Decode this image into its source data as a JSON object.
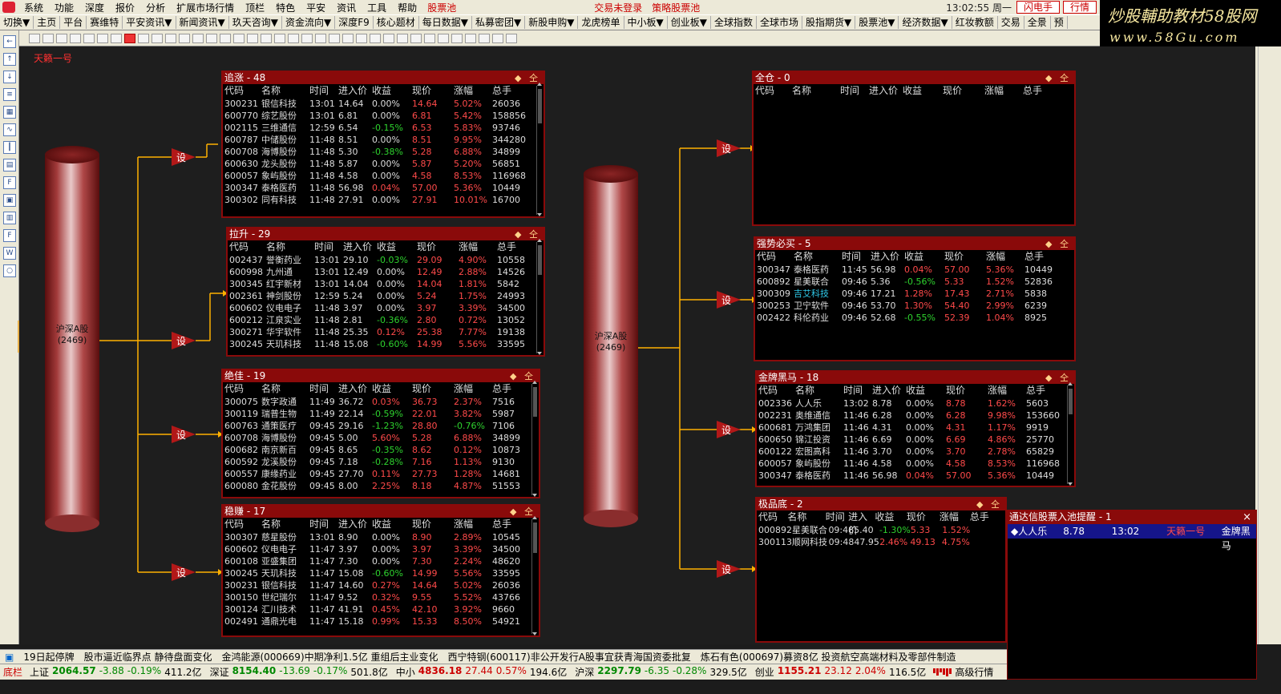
{
  "menu": {
    "items": [
      "系统",
      "功能",
      "深度",
      "报价",
      "分析",
      "扩展市场行情",
      "顶栏",
      "特色",
      "平安",
      "资讯",
      "工具",
      "帮助"
    ],
    "stock_pool": "股票池",
    "trade_status": "交易未登录",
    "strategy": "策略股票池",
    "clock": "13:02:55 周一",
    "flash_btn": "闪电手",
    "quote_btn": "行情"
  },
  "watermark": {
    "line1": "炒股輔助教材58股网",
    "line2": "www.58Gu.com"
  },
  "topbar": {
    "items": [
      "切换▼",
      "主页",
      "平台",
      "赛维特",
      "平安资讯▼",
      "新闻资讯▼",
      "玖天咨询▼",
      "资金流向▼",
      "深度F9",
      "核心题材",
      "每日数据▼",
      "私募密团▼",
      "新股申购▼",
      "龙虎榜单",
      "中小板▼",
      "创业板▼",
      "全球指数",
      "全球市场",
      "股指期货▼",
      "股票池▼",
      "经济数据▼",
      "红妆教额",
      "交易",
      "全景",
      "预"
    ]
  },
  "scheme_title": "天籁一号",
  "node_label": "设",
  "cylinders": [
    {
      "label": "沪深A股",
      "count": "(2469)"
    },
    {
      "label": "沪深A股",
      "count": "(2469)"
    }
  ],
  "columns": [
    "代码",
    "名称",
    "时间",
    "进入价",
    "收益",
    "现价",
    "涨幅",
    "总手"
  ],
  "panels": [
    {
      "title": "追涨 - 48",
      "icons": "◆ 仝",
      "rows": [
        [
          "300231",
          "银信科技",
          "13:01",
          "14.64",
          "0.00%",
          "14.64",
          "5.02%",
          "26036"
        ],
        [
          "600770",
          "综艺股份",
          "13:01",
          "6.81",
          "0.00%",
          "6.81",
          "5.42%",
          "158856"
        ],
        [
          "002115",
          "三维通信",
          "12:59",
          "6.54",
          "-0.15%",
          "6.53",
          "5.83%",
          "93746"
        ],
        [
          "600787",
          "中储股份",
          "11:48",
          "8.51",
          "0.00%",
          "8.51",
          "9.95%",
          "344280"
        ],
        [
          "600708",
          "海博股份",
          "11:48",
          "5.30",
          "-0.38%",
          "5.28",
          "6.88%",
          "34899"
        ],
        [
          "600630",
          "龙头股份",
          "11:48",
          "5.87",
          "0.00%",
          "5.87",
          "5.20%",
          "56851"
        ],
        [
          "600057",
          "象屿股份",
          "11:48",
          "4.58",
          "0.00%",
          "4.58",
          "8.53%",
          "116968"
        ],
        [
          "300347",
          "泰格医药",
          "11:48",
          "56.98",
          "0.04%",
          "57.00",
          "5.36%",
          "10449"
        ],
        [
          "300302",
          "同有科技",
          "11:48",
          "27.91",
          "0.00%",
          "27.91",
          "10.01%",
          "16700"
        ]
      ]
    },
    {
      "title": "拉升 - 29",
      "icons": "◆ 仝",
      "rows": [
        [
          "002437",
          "誉衡药业",
          "13:01",
          "29.10",
          "-0.03%",
          "29.09",
          "4.90%",
          "10558"
        ],
        [
          "600998",
          "九州通",
          "13:01",
          "12.49",
          "0.00%",
          "12.49",
          "2.88%",
          "14526"
        ],
        [
          "300345",
          "红宇新材",
          "13:01",
          "14.04",
          "0.00%",
          "14.04",
          "1.81%",
          "5842"
        ],
        [
          "002361",
          "神剑股份",
          "12:59",
          "5.24",
          "0.00%",
          "5.24",
          "1.75%",
          "24993"
        ],
        [
          "600602",
          "仪电电子",
          "11:48",
          "3.97",
          "0.00%",
          "3.97",
          "3.39%",
          "34500"
        ],
        [
          "600212",
          "江泉实业",
          "11:48",
          "2.81",
          "-0.36%",
          "2.80",
          "0.72%",
          "13052"
        ],
        [
          "300271",
          "华宇软件",
          "11:48",
          "25.35",
          "0.12%",
          "25.38",
          "7.77%",
          "19138"
        ],
        [
          "300245",
          "天玑科技",
          "11:48",
          "15.08",
          "-0.60%",
          "14.99",
          "5.56%",
          "33595"
        ]
      ]
    },
    {
      "title": "绝佳 - 19",
      "icons": "◆ 仝",
      "rows": [
        [
          "300075",
          "数字政通",
          "11:49",
          "36.72",
          "0.03%",
          "36.73",
          "2.37%",
          "7516"
        ],
        [
          "300119",
          "瑞普生物",
          "11:49",
          "22.14",
          "-0.59%",
          "22.01",
          "3.82%",
          "5987"
        ],
        [
          "600763",
          "通策医疗",
          "09:45",
          "29.16",
          "-1.23%",
          "28.80",
          "-0.76%",
          "7106"
        ],
        [
          "600708",
          "海博股份",
          "09:45",
          "5.00",
          "5.60%",
          "5.28",
          "6.88%",
          "34899"
        ],
        [
          "600682",
          "南京新百",
          "09:45",
          "8.65",
          "-0.35%",
          "8.62",
          "0.12%",
          "10873"
        ],
        [
          "600592",
          "龙溪股份",
          "09:45",
          "7.18",
          "-0.28%",
          "7.16",
          "1.13%",
          "9130"
        ],
        [
          "600557",
          "康缘药业",
          "09:45",
          "27.70",
          "0.11%",
          "27.73",
          "1.28%",
          "14681"
        ],
        [
          "600080",
          "金花股份",
          "09:45",
          "8.00",
          "2.25%",
          "8.18",
          "4.87%",
          "51553"
        ]
      ]
    },
    {
      "title": "稳赚 - 17",
      "icons": "◆ 仝",
      "rows": [
        [
          "300307",
          "慈星股份",
          "13:01",
          "8.90",
          "0.00%",
          "8.90",
          "2.89%",
          "10545"
        ],
        [
          "600602",
          "仪电电子",
          "11:47",
          "3.97",
          "0.00%",
          "3.97",
          "3.39%",
          "34500"
        ],
        [
          "600108",
          "亚盛集团",
          "11:47",
          "7.30",
          "0.00%",
          "7.30",
          "2.24%",
          "48620"
        ],
        [
          "300245",
          "天玑科技",
          "11:47",
          "15.08",
          "-0.60%",
          "14.99",
          "5.56%",
          "33595"
        ],
        [
          "300231",
          "银信科技",
          "11:47",
          "14.60",
          "0.27%",
          "14.64",
          "5.02%",
          "26036"
        ],
        [
          "300150",
          "世纪瑞尔",
          "11:47",
          "9.52",
          "0.32%",
          "9.55",
          "5.52%",
          "43766"
        ],
        [
          "300124",
          "汇川技术",
          "11:47",
          "41.91",
          "0.45%",
          "42.10",
          "3.92%",
          "9660"
        ],
        [
          "002491",
          "通鼎光电",
          "11:47",
          "15.18",
          "0.99%",
          "15.33",
          "8.50%",
          "54921"
        ]
      ]
    },
    {
      "title": "全仓 - 0",
      "icons": "◆ 仝",
      "rows": []
    },
    {
      "title": "强势必买 - 5",
      "icons": "◆ 仝",
      "rows": [
        [
          "300347",
          "泰格医药",
          "11:45",
          "56.98",
          "0.04%",
          "57.00",
          "5.36%",
          "10449"
        ],
        [
          "600892",
          "星美联合",
          "09:46",
          "5.36",
          "-0.56%",
          "5.33",
          "1.52%",
          "52836"
        ],
        [
          "300309",
          "吉艾科技",
          "09:46",
          "17.21",
          "1.28%",
          "17.43",
          "2.71%",
          "5838"
        ],
        [
          "300253",
          "卫宁软件",
          "09:46",
          "53.70",
          "1.30%",
          "54.40",
          "2.99%",
          "6239"
        ],
        [
          "002422",
          "科伦药业",
          "09:46",
          "52.68",
          "-0.55%",
          "52.39",
          "1.04%",
          "8925"
        ]
      ]
    },
    {
      "title": "金牌黑马 - 18",
      "icons": "◆ 仝",
      "rows": [
        [
          "002336",
          "人人乐",
          "13:02",
          "8.78",
          "0.00%",
          "8.78",
          "1.62%",
          "5603"
        ],
        [
          "002231",
          "奥维通信",
          "11:46",
          "6.28",
          "0.00%",
          "6.28",
          "9.98%",
          "153660"
        ],
        [
          "600681",
          "万鸿集团",
          "11:46",
          "4.31",
          "0.00%",
          "4.31",
          "1.17%",
          "9919"
        ],
        [
          "600650",
          "锦江投资",
          "11:46",
          "6.69",
          "0.00%",
          "6.69",
          "4.86%",
          "25770"
        ],
        [
          "600122",
          "宏图高科",
          "11:46",
          "3.70",
          "0.00%",
          "3.70",
          "2.78%",
          "65829"
        ],
        [
          "600057",
          "象屿股份",
          "11:46",
          "4.58",
          "0.00%",
          "4.58",
          "8.53%",
          "116968"
        ],
        [
          "300347",
          "泰格医药",
          "11:46",
          "56.98",
          "0.04%",
          "57.00",
          "5.36%",
          "10449"
        ]
      ]
    },
    {
      "title": "极品底 - 2",
      "icons": "◆ 仝",
      "rows": [
        [
          "000892",
          "星美联合",
          "09:48",
          "5.40",
          "-1.30%",
          "5.33",
          "1.52%",
          ""
        ],
        [
          "300113",
          "顺网科技",
          "09:48",
          "47.95",
          "2.46%",
          "49.13",
          "4.75%",
          ""
        ]
      ]
    }
  ],
  "alert": {
    "title": "通达信股票入池提醒 - 1",
    "close": "×",
    "row": {
      "name": "◆人人乐",
      "price": "8.78",
      "time": "13:02",
      "scheme": "天籁一号",
      "pool": "金牌黑马"
    }
  },
  "ticker": {
    "items": [
      "19日起停牌",
      "股市逼近临界点  静待盘面变化",
      "金鸿能源(000669)中期净利1.5亿  重组后主业变化",
      "西宁特钢(600117)非公开发行A股事宜获青海国资委批复",
      "炼石有色(000697)募资8亿  投资航空高端材料及零部件制造"
    ]
  },
  "bottom": {
    "label": "底栏",
    "indices": [
      {
        "name": "上证",
        "val": "2064.57",
        "chg": "-3.88",
        "pct": "-0.19%",
        "amt": "411.2亿"
      },
      {
        "name": "深证",
        "val": "8154.40",
        "chg": "-13.69",
        "pct": "-0.17%",
        "amt": "501.8亿"
      },
      {
        "name": "中小",
        "val": "4836.18",
        "chg": "27.44",
        "pct": "0.57%",
        "amt": "194.6亿"
      },
      {
        "name": "沪深",
        "val": "2297.79",
        "chg": "-6.35",
        "pct": "-0.28%",
        "amt": "329.5亿"
      },
      {
        "name": "创业",
        "val": "1155.21",
        "chg": "23.12",
        "pct": "2.04%",
        "amt": "116.5亿"
      }
    ],
    "advanced": "高级行情"
  },
  "colors": {
    "panel_header": "#8a0a0a",
    "up": "#ff4a4a",
    "down": "#2ed32e",
    "line": "#ffb000",
    "alert_row": "#15158a"
  }
}
